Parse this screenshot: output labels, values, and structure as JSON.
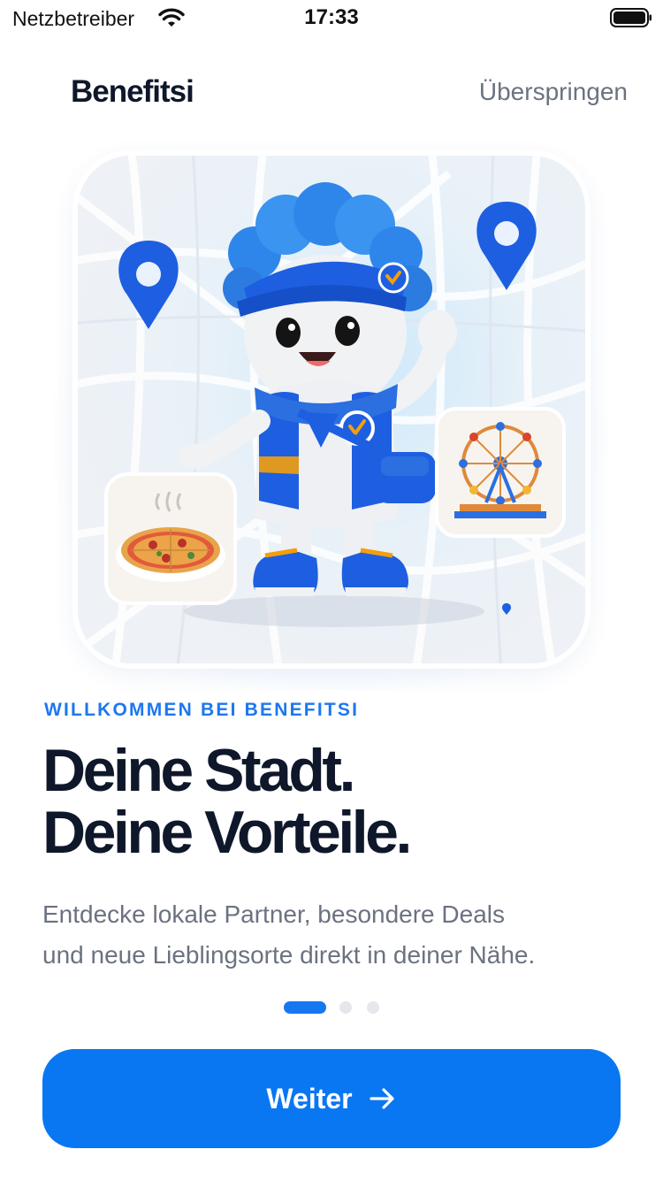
{
  "status_bar": {
    "carrier": "Netzbetreiber",
    "time": "17:33"
  },
  "header": {
    "brand": "Benefitsi",
    "skip_label": "Überspringen"
  },
  "hero": {
    "illustration": "mascot-with-map-pins-pizza-ferris-wheel"
  },
  "content": {
    "eyebrow": "WILLKOMMEN BEI BENEFITSI",
    "headline_line1": "Deine Stadt.",
    "headline_line2": "Deine Vorteile.",
    "description_line1": "Entdecke lokale Partner, besondere Deals",
    "description_line2": "und neue Lieblingsorte direkt in deiner Nähe."
  },
  "pager": {
    "total": 3,
    "active": 1
  },
  "cta": {
    "label": "Weiter",
    "icon": "arrow-right-icon"
  },
  "colors": {
    "accent": "#0a77f2",
    "text_dark": "#0f172a",
    "text_muted": "#6b7280",
    "eyebrow": "#1d77ef"
  }
}
